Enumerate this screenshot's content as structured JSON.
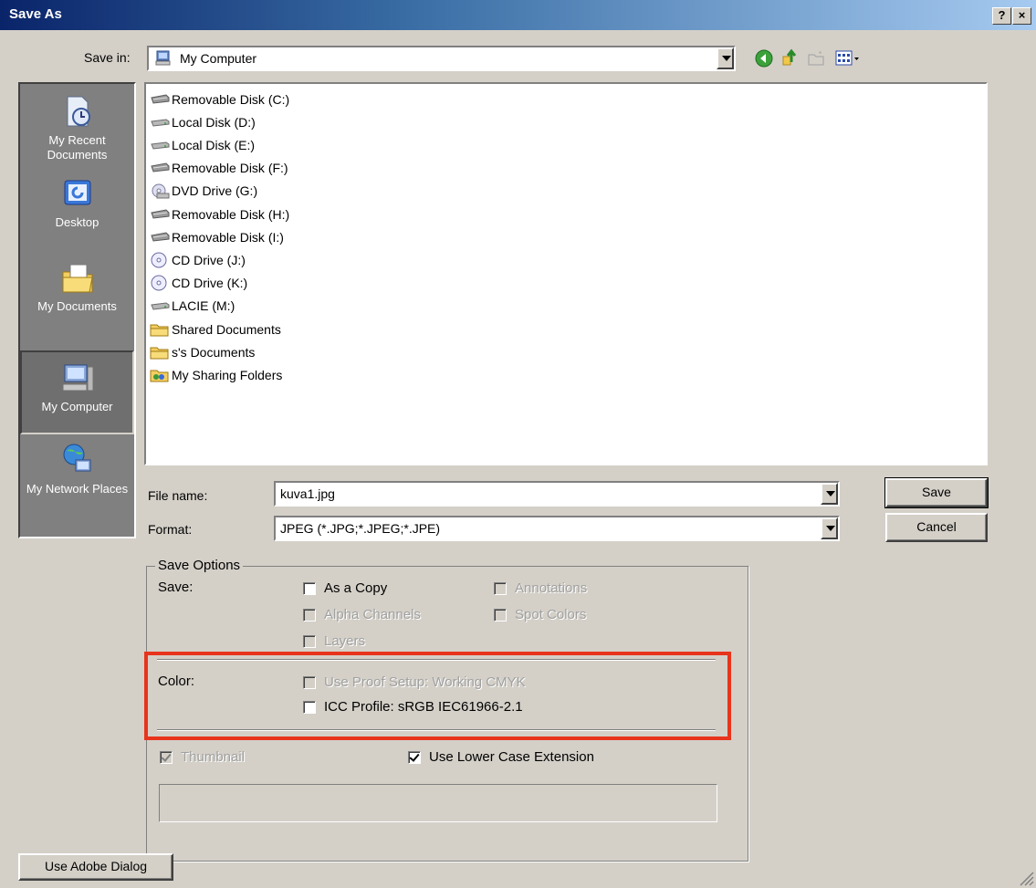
{
  "window": {
    "title": "Save As",
    "help_label": "?",
    "close_label": "×"
  },
  "toolbar": {
    "save_in_label": "Save in:",
    "save_in_value": "My Computer"
  },
  "places": [
    {
      "label": "My Recent Documents"
    },
    {
      "label": "Desktop"
    },
    {
      "label": "My Documents"
    },
    {
      "label": "My Computer"
    },
    {
      "label": "My Network Places"
    }
  ],
  "files": [
    {
      "label": "Removable Disk (C:)",
      "icon": "removable-disk-icon"
    },
    {
      "label": "Local Disk (D:)",
      "icon": "local-disk-icon"
    },
    {
      "label": "Local Disk (E:)",
      "icon": "local-disk-icon"
    },
    {
      "label": "Removable Disk (F:)",
      "icon": "removable-disk-icon"
    },
    {
      "label": "DVD Drive (G:)",
      "icon": "dvd-drive-icon"
    },
    {
      "label": "Removable Disk (H:)",
      "icon": "removable-disk-icon"
    },
    {
      "label": "Removable Disk (I:)",
      "icon": "removable-disk-icon"
    },
    {
      "label": "CD Drive (J:)",
      "icon": "cd-drive-icon"
    },
    {
      "label": "CD Drive (K:)",
      "icon": "cd-drive-icon"
    },
    {
      "label": "LACIE (M:)",
      "icon": "local-disk-icon"
    },
    {
      "label": "Shared Documents",
      "icon": "folder-icon"
    },
    {
      "label": "s's Documents",
      "icon": "folder-icon"
    },
    {
      "label": "My Sharing Folders",
      "icon": "sharing-folder-icon"
    }
  ],
  "form": {
    "file_name_label": "File name:",
    "file_name_value": "kuva1.jpg",
    "format_label": "Format:",
    "format_value": "JPEG (*.JPG;*.JPEG;*.JPE)",
    "save_button": "Save",
    "cancel_button": "Cancel"
  },
  "options": {
    "legend": "Save Options",
    "save_label": "Save:",
    "as_a_copy": "As a Copy",
    "annotations": "Annotations",
    "alpha_channels": "Alpha Channels",
    "spot_colors": "Spot Colors",
    "layers": "Layers",
    "color_label": "Color:",
    "use_proof_setup": "Use Proof Setup:  Working CMYK",
    "icc_profile": "ICC Profile:  sRGB IEC61966-2.1",
    "thumbnail": "Thumbnail",
    "use_lower_case_extension": "Use Lower Case Extension"
  },
  "footer": {
    "adobe_dialog_button": "Use Adobe Dialog"
  },
  "colors": {
    "highlight": "#e8341c",
    "title_bar_start": "#0a246a"
  }
}
